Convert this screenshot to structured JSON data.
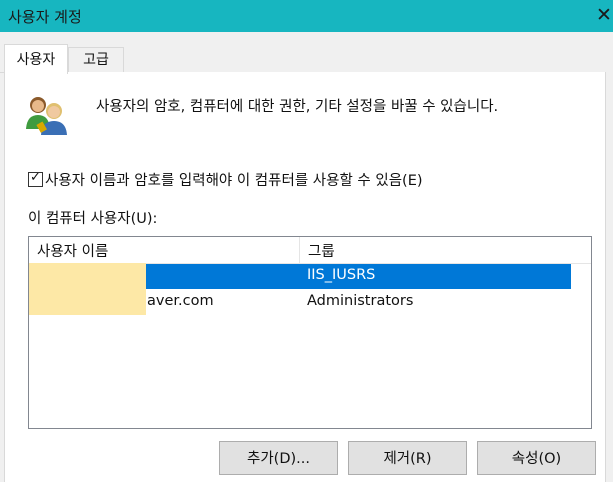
{
  "window": {
    "title": "사용자 계정",
    "ghost_left": "",
    "ghost_mid": "",
    "ghost_right": ""
  },
  "tabs": [
    {
      "label": "사용자"
    },
    {
      "label": "고급"
    }
  ],
  "description": "사용자의 암호, 컴퓨터에 대한 권한, 기타 설정을 바꿀 수 있습니다.",
  "checkbox": {
    "label": "사용자 이름과 암호를 입력해야 이 컴퓨터를 사용할 수 있음(E)",
    "checked": true,
    "mark": "✓"
  },
  "users_list": {
    "label": "이 컴퓨터 사용자(U):",
    "columns": [
      "사용자 이름",
      "그룹"
    ],
    "rows": [
      {
        "name": "",
        "group": "IIS_IUSRS"
      },
      {
        "name": "aver.com",
        "group": "Administrators"
      }
    ]
  },
  "buttons": {
    "add": "추가(D)...",
    "remove": "제거(R)",
    "properties": "속성(O)"
  },
  "colors": {
    "titlebar": "#17b6c0",
    "selection": "#0078d7",
    "redaction": "#fde8a6"
  }
}
